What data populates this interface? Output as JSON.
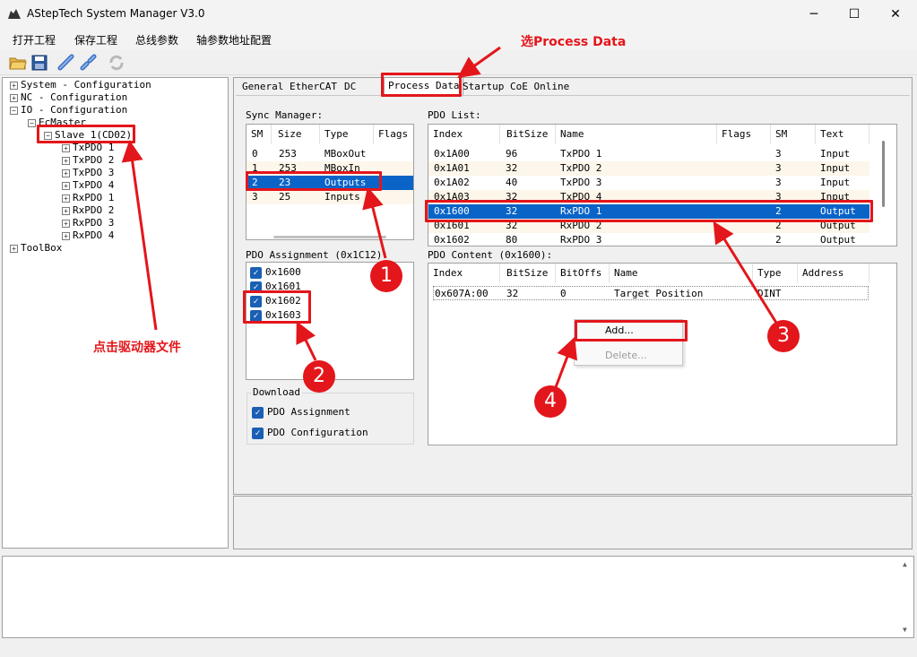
{
  "window": {
    "title": "AStepTech System Manager V3.0",
    "minimize": "─",
    "maximize": "☐",
    "close": "✕"
  },
  "menu": [
    "打开工程",
    "保存工程",
    "总线参数",
    "轴参数地址配置"
  ],
  "toolbar_icons": [
    "open-folder-icon",
    "save-icon",
    "connect-icon",
    "disconnect-icon",
    "refresh-icon"
  ],
  "tree": {
    "system": "System - Configuration",
    "nc": "NC - Configuration",
    "io": "IO - Configuration",
    "ecmaster": "EcMaster",
    "slave": "Slave 1(CD02)",
    "pdos": [
      "TxPDO 1",
      "TxPDO 2",
      "TxPDO 3",
      "TxPDO 4",
      "RxPDO 1",
      "RxPDO 2",
      "RxPDO 3",
      "RxPDO 4"
    ],
    "toolbox": "ToolBox"
  },
  "tabs": [
    "General",
    "EtherCAT",
    "DC",
    "Process Data",
    "Startup",
    "CoE Online"
  ],
  "sync_manager": {
    "label": "Sync Manager:",
    "headers": [
      "SM",
      "Size",
      "Type",
      "Flags"
    ],
    "rows": [
      [
        "0",
        "253",
        "MBoxOut",
        ""
      ],
      [
        "1",
        "253",
        "MBoxIn",
        ""
      ],
      [
        "2",
        "23",
        "Outputs",
        ""
      ],
      [
        "3",
        "25",
        "Inputs",
        ""
      ]
    ]
  },
  "pdo_list": {
    "label": "PDO List:",
    "headers": [
      "Index",
      "BitSize",
      "Name",
      "Flags",
      "SM",
      "Text"
    ],
    "rows": [
      [
        "0x1A00",
        "96",
        "TxPDO 1",
        "",
        "3",
        "Input"
      ],
      [
        "0x1A01",
        "32",
        "TxPDO 2",
        "",
        "3",
        "Input"
      ],
      [
        "0x1A02",
        "40",
        "TxPDO 3",
        "",
        "3",
        "Input"
      ],
      [
        "0x1A03",
        "32",
        "TxPDO 4",
        "",
        "3",
        "Input"
      ],
      [
        "0x1600",
        "32",
        "RxPDO 1",
        "",
        "2",
        "Output"
      ],
      [
        "0x1601",
        "32",
        "RxPDO 2",
        "",
        "2",
        "Output"
      ],
      [
        "0x1602",
        "80",
        "RxPDO 3",
        "",
        "2",
        "Output"
      ]
    ]
  },
  "pdo_assignment": {
    "label": "PDO Assignment (0x1C12):",
    "items": [
      "0x1600",
      "0x1601",
      "0x1602",
      "0x1603"
    ]
  },
  "pdo_content": {
    "label": "PDO Content (0x1600):",
    "headers": [
      "Index",
      "BitSize",
      "BitOffs",
      "Name",
      "Type",
      "Address"
    ],
    "rows": [
      [
        "0x607A:00",
        "32",
        "0",
        "Target Position",
        "DINT",
        ""
      ]
    ]
  },
  "download": {
    "label": "Download",
    "items": [
      "PDO Assignment",
      "PDO Configuration"
    ]
  },
  "context_menu": {
    "add": "Add...",
    "delete": "Delete..."
  },
  "annotations": {
    "select_pd": "选Process Data",
    "click_driver": "点击驱动器文件",
    "badges": [
      "1",
      "2",
      "3",
      "4"
    ]
  },
  "colors": {
    "annotation_red": "#e3161b",
    "selection_blue": "#0a64c8",
    "checkbox_blue": "#1a5fb4",
    "alt_row": "#fdf6ea"
  }
}
